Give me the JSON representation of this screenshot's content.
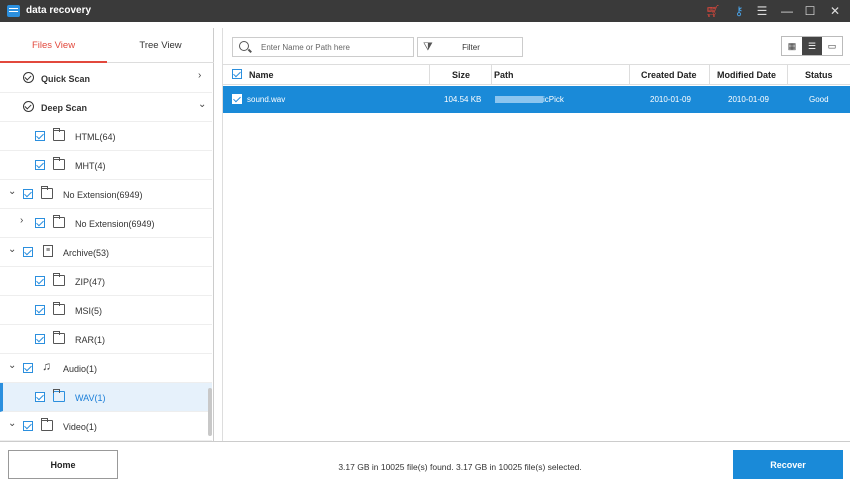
{
  "app": {
    "title": "data recovery"
  },
  "titlebar_icons": [
    "cart-icon",
    "key-icon",
    "menu-icon",
    "minimize-icon",
    "maximize-icon",
    "close-icon"
  ],
  "left_tabs": [
    {
      "label": "Files View",
      "active": true
    },
    {
      "label": "Tree View",
      "active": false
    }
  ],
  "tree": {
    "quick_scan": "Quick Scan",
    "deep_scan": "Deep Scan",
    "items": [
      {
        "label": "HTML(64)"
      },
      {
        "label": "MHT(4)"
      },
      {
        "label": "No Extension(6949)"
      },
      {
        "label": "No Extension(6949)"
      },
      {
        "label": "Archive(53)"
      },
      {
        "label": "ZIP(47)"
      },
      {
        "label": "MSI(5)"
      },
      {
        "label": "RAR(1)"
      },
      {
        "label": "Audio(1)"
      },
      {
        "label": "WAV(1)",
        "selected": true
      },
      {
        "label": "Video(1)"
      }
    ]
  },
  "toolbar": {
    "search_placeholder": "Enter Name or Path here",
    "filter_label": "Filter"
  },
  "table": {
    "headers": {
      "name": "Name",
      "size": "Size",
      "path": "Path",
      "created": "Created Date",
      "modified": "Modified Date",
      "status": "Status"
    },
    "rows": [
      {
        "name": "sound.wav",
        "size": "104.54 KB",
        "path": "icPick",
        "created": "2010-01-09",
        "modified": "2010-01-09",
        "status": "Good",
        "selected": true
      }
    ]
  },
  "footer": {
    "home_label": "Home",
    "status_text": "3.17 GB in 10025 file(s) found.   3.17 GB in 10025 file(s) selected.",
    "recover_label": "Recover"
  },
  "colors": {
    "accent": "#1a8ad8",
    "tab_active": "#e2483c",
    "titlebar": "#3a3a3a"
  }
}
